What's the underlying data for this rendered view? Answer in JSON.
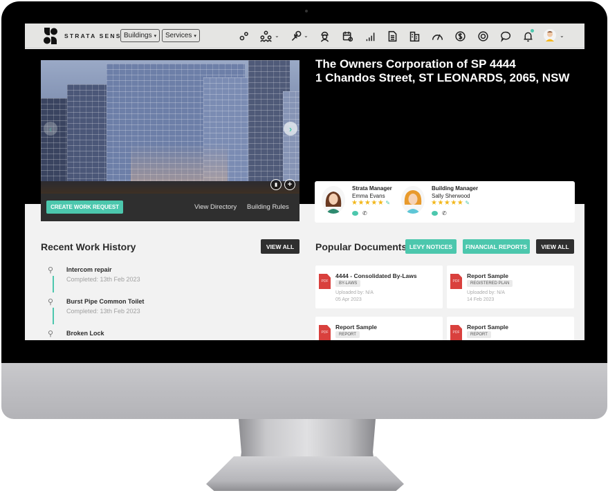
{
  "navbar": {
    "brand": "STRATA SENSE",
    "buildings_label": "Buildings",
    "services_label": "Services",
    "icons": [
      {
        "name": "settings-gears-icon",
        "has_dropdown": false
      },
      {
        "name": "people-network-icon",
        "has_dropdown": true
      },
      {
        "name": "wrench-icon",
        "has_dropdown": true
      },
      {
        "name": "contractor-icon",
        "has_dropdown": false
      },
      {
        "name": "calendar-clock-icon",
        "has_dropdown": false
      },
      {
        "name": "bar-chart-icon",
        "has_dropdown": false
      },
      {
        "name": "document-icon",
        "has_dropdown": false
      },
      {
        "name": "buildings-icon",
        "has_dropdown": false
      },
      {
        "name": "gauge-icon",
        "has_dropdown": false
      },
      {
        "name": "dollar-icon",
        "has_dropdown": false
      },
      {
        "name": "lifebuoy-icon",
        "has_dropdown": false
      },
      {
        "name": "chat-icon",
        "has_dropdown": false
      },
      {
        "name": "bell-icon",
        "has_dropdown": false
      }
    ],
    "chevron": "⌄",
    "accent": "#4cc7ad"
  },
  "hero": {
    "title_line1": "The Owners Corporation of SP 4444",
    "title_line2": "1 Chandos Street, ST LEONARDS, 2065, NSW",
    "slider_prev": "‹",
    "slider_next": "›",
    "trash_glyph": "▮",
    "add_glyph": "+",
    "create_work_request": "CREATE WORK REQUEST",
    "view_directory": "View Directory",
    "building_rules": "Building Rules"
  },
  "managers": [
    {
      "role": "Strata Manager",
      "name": "Emma Evans",
      "rating": 5,
      "stars": "★★★★★",
      "edit": "✎",
      "phone": "✆"
    },
    {
      "role": "Building Manager",
      "name": "Sally Sherwood",
      "rating": 5,
      "stars": "★★★★★",
      "edit": "✎",
      "phone": "✆"
    }
  ],
  "work_history": {
    "title": "Recent Work History",
    "view_all": "VIEW ALL",
    "icon": "⚲",
    "items": [
      {
        "name": "Intercom repair",
        "status": "Completed: 13th Feb 2023"
      },
      {
        "name": "Burst Pipe Common Toilet",
        "status": "Completed: 13th Feb 2023"
      },
      {
        "name": "Broken Lock",
        "status": ""
      }
    ]
  },
  "documents": {
    "title": "Popular Documents",
    "levy_notices": "LEVY NOTICES",
    "financial_reports": "FINANCIAL REPORTS",
    "view_all": "VIEW ALL",
    "pdf_label": "PDF",
    "items": [
      {
        "name": "4444 - Consolidated By-Laws",
        "tag": "BY-LAWS",
        "uploaded_by": "Uploaded by: N/A",
        "date": "05 Apr 2023"
      },
      {
        "name": "Report Sample",
        "tag": "REGISTERED PLAN",
        "uploaded_by": "Uploaded by: N/A",
        "date": "14 Feb 2023"
      },
      {
        "name": "Report Sample",
        "tag": "REPORT",
        "uploaded_by": "",
        "date": ""
      },
      {
        "name": "Report Sample",
        "tag": "REPORT",
        "uploaded_by": "",
        "date": ""
      }
    ]
  }
}
